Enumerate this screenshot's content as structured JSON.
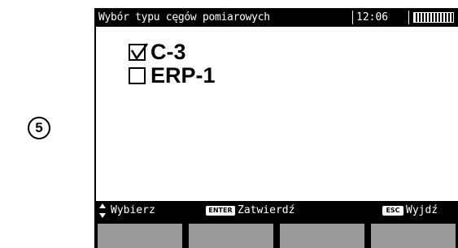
{
  "step_marker": "5",
  "header": {
    "title": "Wybór typu cęgów pomiarowych",
    "time": "12:06",
    "battery_icon": "battery-full-icon"
  },
  "options": [
    {
      "label": "C-3",
      "checked": true
    },
    {
      "label": "ERP-1",
      "checked": false
    }
  ],
  "statusbar": {
    "arrows_icon": "up-down-arrows-icon",
    "select_label": "Wybierz",
    "enter_key": "ENTER",
    "confirm_label": "Zatwierdź",
    "esc_key": "ESC",
    "exit_label": "Wyjdź"
  },
  "softkey_color": "#9a9a9a"
}
